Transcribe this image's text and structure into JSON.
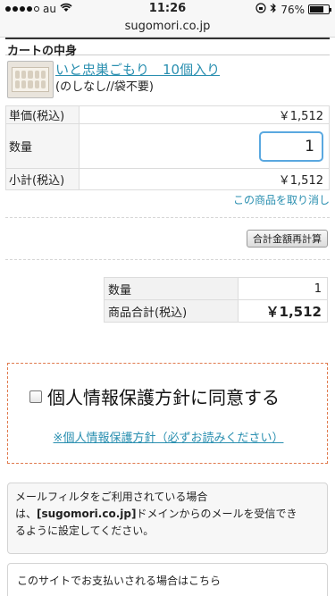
{
  "status_bar": {
    "carrier": "au",
    "time": "11:26",
    "battery_percent": "76%",
    "battery_level": 0.76
  },
  "url": "sugomori.co.jp",
  "cart": {
    "header": "カートの中身",
    "product": {
      "name": "いと忠巣ごもり　10個入り",
      "options": "(のしなし//袋不要)"
    },
    "rows": {
      "unit_price_label": "単価(税込)",
      "unit_price_value": "￥1,512",
      "quantity_label": "数量",
      "quantity_value": "1",
      "subtotal_label": "小計(税込)",
      "subtotal_value": "￥1,512"
    },
    "remove_link": "この商品を取り消し",
    "recalc_button": "合計金額再計算"
  },
  "totals": {
    "quantity_label": "数量",
    "quantity_value": "1",
    "total_label": "商品合計(税込)",
    "total_value": "￥1,512"
  },
  "privacy": {
    "consent_label": "個人情報保護方針に同意する",
    "policy_link": "※個人情報保護方針（必ずお読みください）"
  },
  "mail_notice": {
    "line1": "メールフィルタをご利用されている場合",
    "line2_prefix": "は、",
    "domain": "[sugomori.co.jp]",
    "line2_suffix": "ドメインからのメールを受信でき",
    "line3": "るように設定してください。"
  },
  "payment_notice": {
    "text": "このサイトでお支払いされる場合はこちら"
  }
}
